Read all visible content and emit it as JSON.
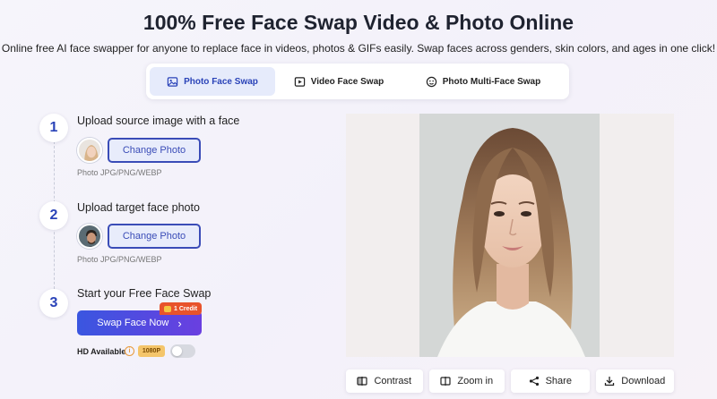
{
  "header": {
    "title": "100% Free Face Swap Video & Photo Online",
    "subtitle": "Online free AI face swapper for anyone to replace face in videos, photos & GIFs easily. Swap faces across genders, skin colors, and ages in one click!"
  },
  "tabs": [
    {
      "label": "Photo Face Swap",
      "icon": "image-icon",
      "active": true
    },
    {
      "label": "Video Face Swap",
      "icon": "video-icon",
      "active": false
    },
    {
      "label": "Photo Multi-Face Swap",
      "icon": "multi-face-icon",
      "active": false
    }
  ],
  "steps": [
    {
      "num": "1",
      "title": "Upload source image with a face",
      "button": "Change Photo",
      "hint": "Photo JPG/PNG/WEBP"
    },
    {
      "num": "2",
      "title": "Upload target face photo",
      "button": "Change Photo",
      "hint": "Photo JPG/PNG/WEBP"
    },
    {
      "num": "3",
      "title": "Start your Free Face Swap"
    }
  ],
  "swap": {
    "label": "Swap Face Now",
    "credit": "1 Credit",
    "hd_label": "HD Available",
    "resolution": "1080P",
    "hd_enabled": false
  },
  "actions": [
    {
      "label": "Contrast",
      "icon": "contrast-icon"
    },
    {
      "label": "Zoom in",
      "icon": "zoom-in-icon"
    },
    {
      "label": "Share",
      "icon": "share-icon"
    },
    {
      "label": "Download",
      "icon": "download-icon"
    }
  ],
  "colors": {
    "accent": "#2a43b8",
    "button_gradient_start": "#3a56e0",
    "button_gradient_end": "#6a3fe0",
    "credit_badge": "#e8532b"
  }
}
